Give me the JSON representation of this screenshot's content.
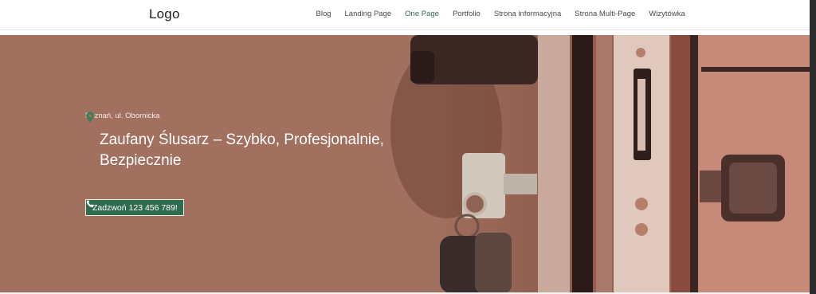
{
  "header": {
    "logo": "Logo",
    "nav": [
      {
        "label": "Blog",
        "active": false
      },
      {
        "label": "Landing Page",
        "active": false
      },
      {
        "label": "One Page",
        "active": true
      },
      {
        "label": "Portfolio",
        "active": false
      },
      {
        "label": "Strona informacyjna",
        "active": false
      },
      {
        "label": "Strona Multi-Page",
        "active": false
      },
      {
        "label": "Wizytówka",
        "active": false
      }
    ]
  },
  "hero": {
    "location": "Poznań, ul. Obornicka",
    "location_icon": "map-pin-icon",
    "headline": "Zaufany Ślusarz – Szybko, Profesjonalnie, Bezpiecznie",
    "cta_label": "Zadzwoń 123 456 789!",
    "cta_icon": "phone-icon",
    "background_image": "door-lock-with-keys-photo"
  },
  "colors": {
    "accent": "#2f6b4f",
    "hero_tint": "#a06d5b"
  }
}
